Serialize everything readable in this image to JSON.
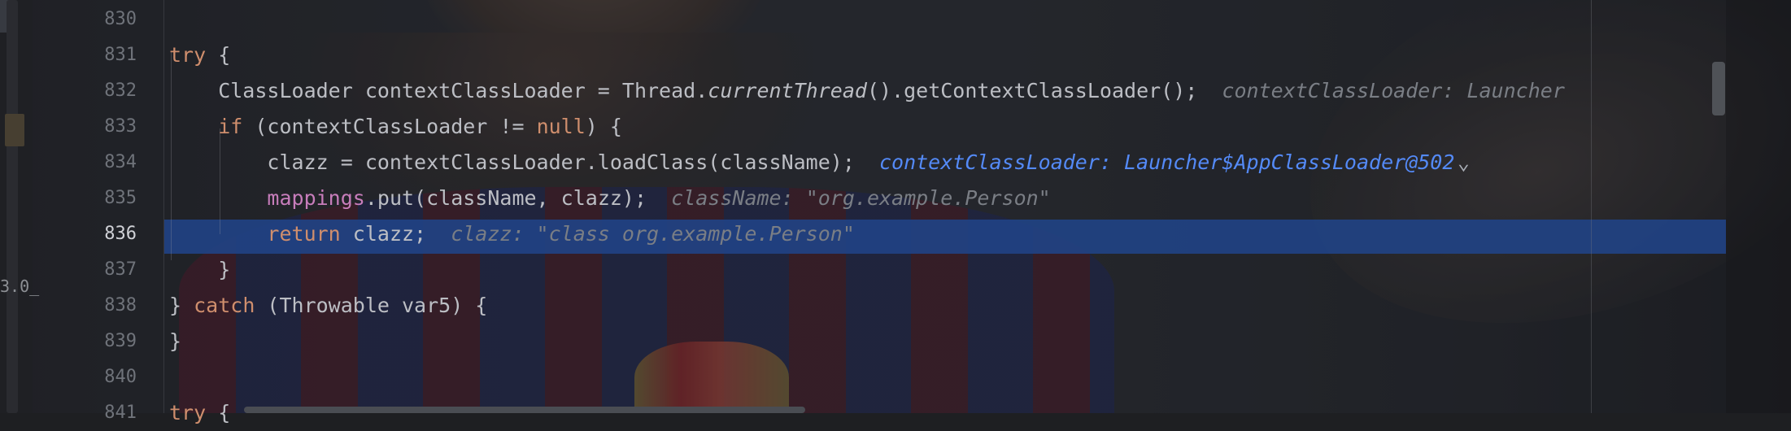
{
  "editor": {
    "side_text": "3.0_",
    "lines": [
      {
        "number": "830",
        "current": false,
        "tokens": []
      },
      {
        "number": "831",
        "current": false,
        "tokens": [
          {
            "t": "try",
            "c": "kw"
          },
          {
            "t": " {",
            "c": ""
          }
        ]
      },
      {
        "number": "832",
        "current": false,
        "tokens": [
          {
            "t": "    ClassLoader contextClassLoader = Thread.",
            "c": ""
          },
          {
            "t": "currentThread",
            "c": "ital"
          },
          {
            "t": "().getContextClassLoader();",
            "c": ""
          },
          {
            "t": "  contextClassLoader: Launcher",
            "c": "hint"
          }
        ]
      },
      {
        "number": "833",
        "current": false,
        "tokens": [
          {
            "t": "    ",
            "c": ""
          },
          {
            "t": "if",
            "c": "kw"
          },
          {
            "t": " (contextClassLoader != ",
            "c": ""
          },
          {
            "t": "null",
            "c": "kw"
          },
          {
            "t": ") {",
            "c": ""
          }
        ]
      },
      {
        "number": "834",
        "current": false,
        "tokens": [
          {
            "t": "        clazz = contextClassLoader.loadClass(className);",
            "c": ""
          },
          {
            "t": "  contextClassLoader: Launcher$AppClassLoader@502",
            "c": "hint-blue"
          },
          {
            "t": "chevron",
            "c": "chevron"
          }
        ]
      },
      {
        "number": "835",
        "current": false,
        "tokens": [
          {
            "t": "        ",
            "c": ""
          },
          {
            "t": "mappings",
            "c": "fld"
          },
          {
            "t": ".put(className, clazz);",
            "c": ""
          },
          {
            "t": "  className: \"org.example.Person\"",
            "c": "hint"
          }
        ]
      },
      {
        "number": "836",
        "current": true,
        "tokens": [
          {
            "t": "        ",
            "c": ""
          },
          {
            "t": "return",
            "c": "kw"
          },
          {
            "t": " clazz;",
            "c": ""
          },
          {
            "t": "  clazz: \"class org.example.Person\"",
            "c": "hint"
          }
        ]
      },
      {
        "number": "837",
        "current": false,
        "tokens": [
          {
            "t": "    }",
            "c": ""
          }
        ]
      },
      {
        "number": "838",
        "current": false,
        "tokens": [
          {
            "t": "} ",
            "c": ""
          },
          {
            "t": "catch",
            "c": "kw"
          },
          {
            "t": " (Throwable var5) {",
            "c": ""
          }
        ]
      },
      {
        "number": "839",
        "current": false,
        "tokens": [
          {
            "t": "}",
            "c": ""
          }
        ]
      },
      {
        "number": "840",
        "current": false,
        "tokens": []
      },
      {
        "number": "841",
        "current": false,
        "tokens": [
          {
            "t": "try",
            "c": "kw"
          },
          {
            "t": " {",
            "c": ""
          }
        ]
      }
    ]
  },
  "colors": {
    "keyword": "#cf8e6d",
    "field": "#c77dbb",
    "text": "#bcbec4",
    "inline_hint": "#7a7e85",
    "inline_hint_expanded": "#548af7",
    "execution_line": "#214283"
  },
  "icons": {
    "expand_hint": "chevron-down-icon"
  }
}
